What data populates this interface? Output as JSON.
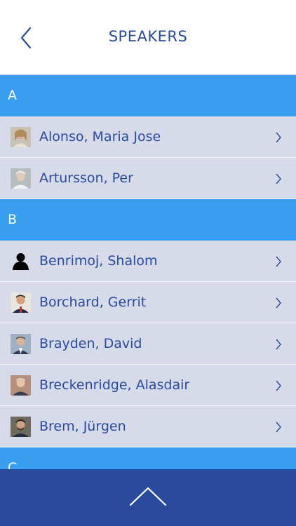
{
  "header": {
    "title": "SPEAKERS",
    "back_icon": "chevron-left-icon"
  },
  "sections": [
    {
      "letter": "A",
      "speakers": [
        {
          "name": "Alonso, Maria Jose",
          "avatar": "photo"
        },
        {
          "name": "Artursson, Per",
          "avatar": "photo"
        }
      ]
    },
    {
      "letter": "B",
      "speakers": [
        {
          "name": "Benrimoj, Shalom",
          "avatar": "silhouette"
        },
        {
          "name": "Borchard, Gerrit",
          "avatar": "photo"
        },
        {
          "name": "Brayden, David",
          "avatar": "photo"
        },
        {
          "name": "Breckenridge, Alasdair",
          "avatar": "photo"
        },
        {
          "name": "Brem, Jürgen",
          "avatar": "photo"
        }
      ]
    },
    {
      "letter": "C",
      "speakers": []
    }
  ],
  "footer": {
    "up_icon": "chevron-up-icon"
  },
  "colors": {
    "primary": "#2a4b9b",
    "section": "#3a9ef0",
    "row": "#d6dae9"
  }
}
